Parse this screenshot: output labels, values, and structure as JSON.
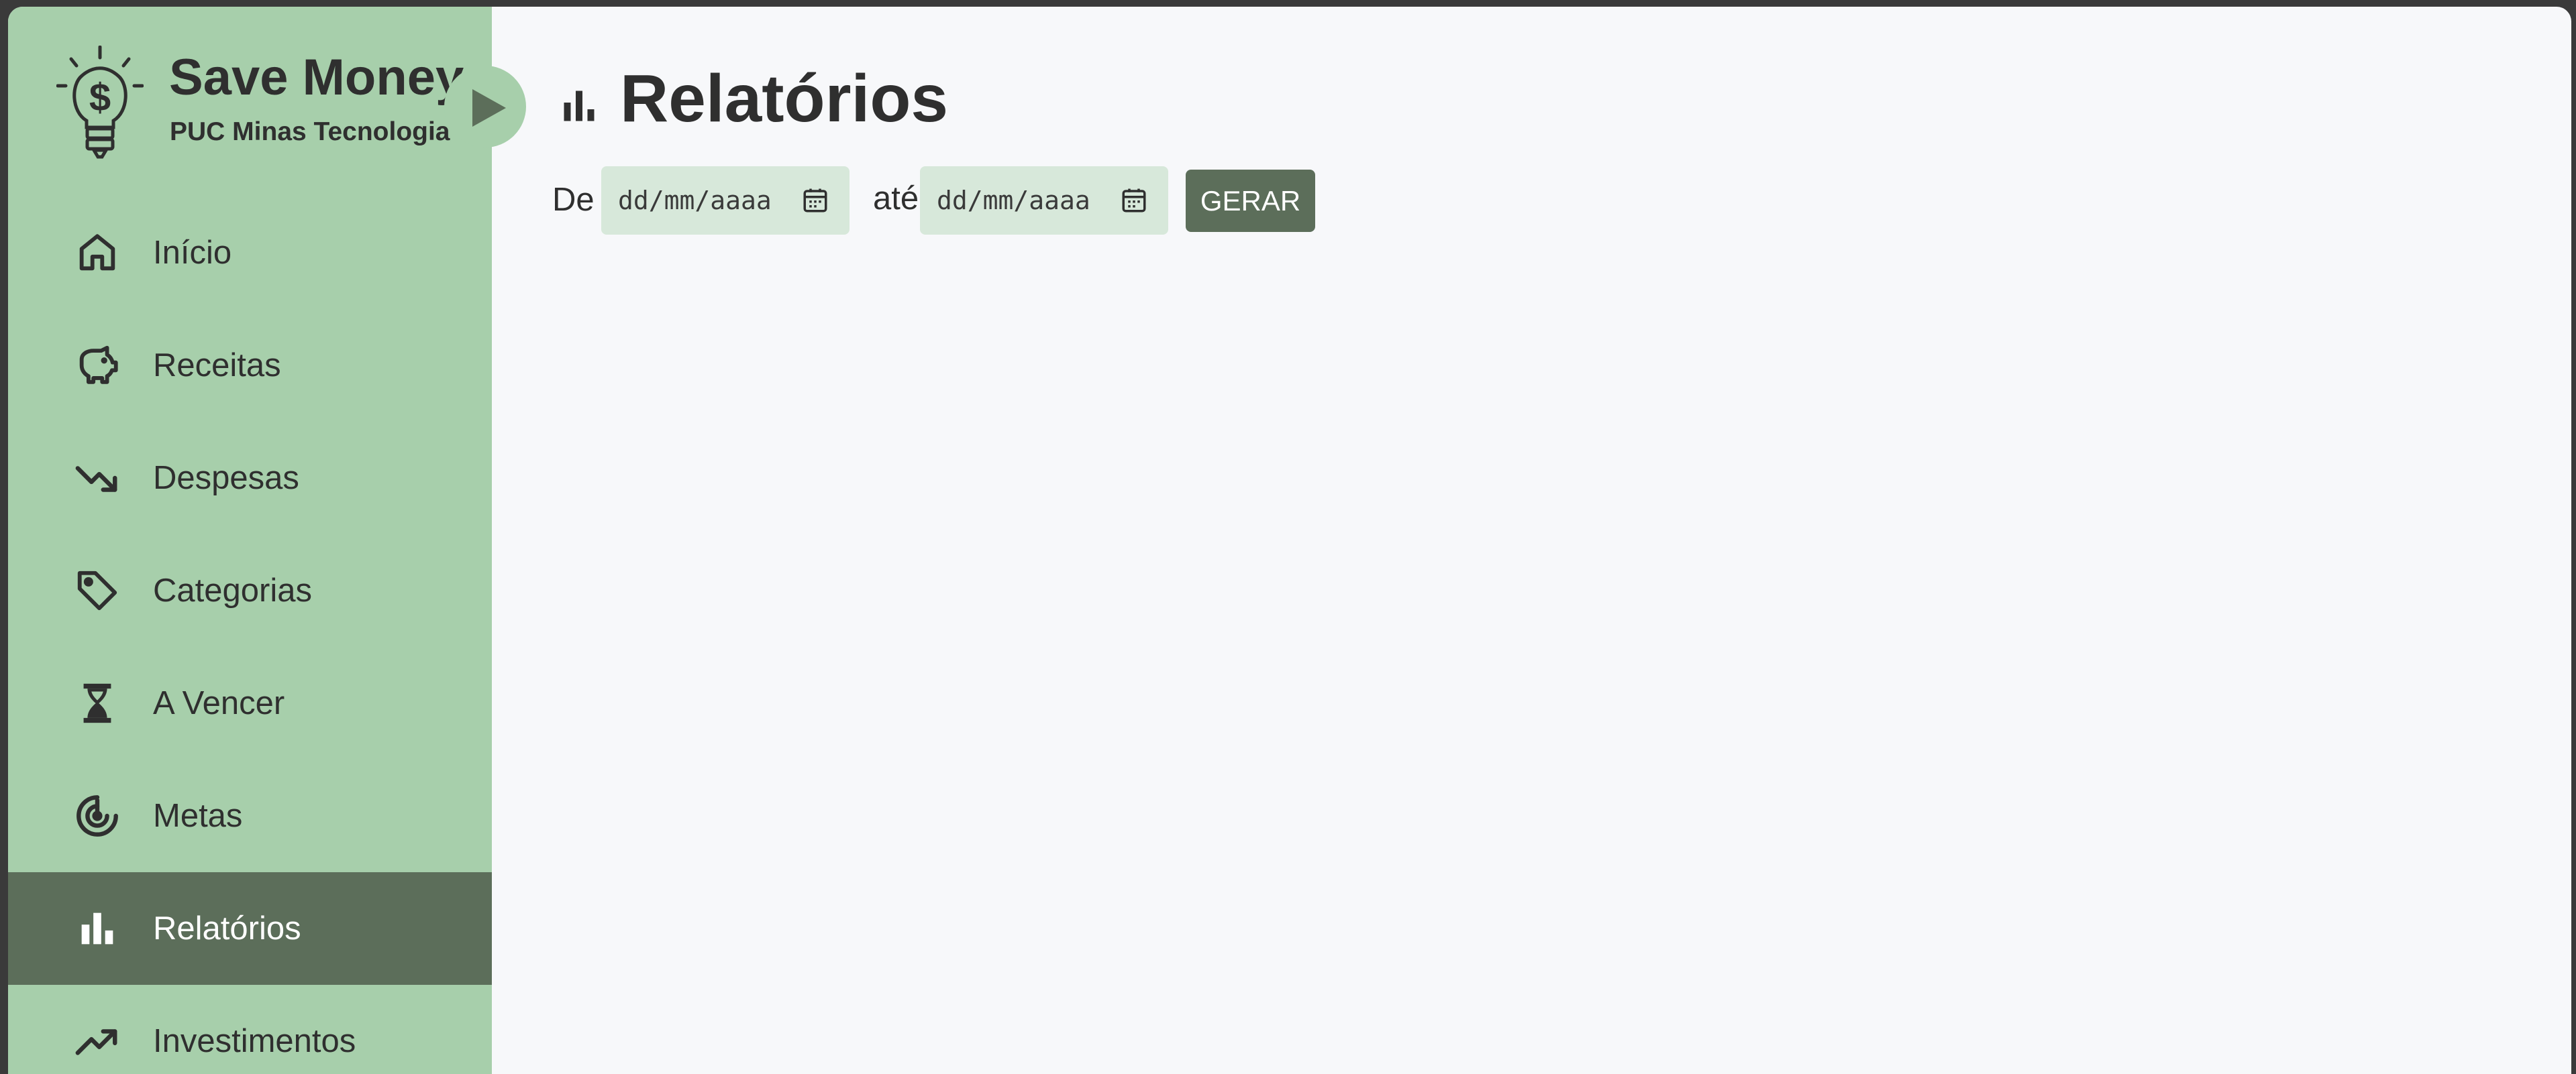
{
  "brand": {
    "title": "Save Money",
    "subtitle": "PUC Minas Tecnologia",
    "logo_icon": "lightbulb-dollar-icon"
  },
  "sidebar_toggle_icon": "play-arrow-icon",
  "nav": {
    "items": [
      {
        "label": "Início",
        "icon": "home-icon",
        "active": false
      },
      {
        "label": "Receitas",
        "icon": "piggy-bank-icon",
        "active": false
      },
      {
        "label": "Despesas",
        "icon": "trending-down-icon",
        "active": false
      },
      {
        "label": "Categorias",
        "icon": "tag-icon",
        "active": false
      },
      {
        "label": "A Vencer",
        "icon": "hourglass-icon",
        "active": false
      },
      {
        "label": "Metas",
        "icon": "target-icon",
        "active": false
      },
      {
        "label": "Relatórios",
        "icon": "bar-chart-icon",
        "active": true
      },
      {
        "label": "Investimentos",
        "icon": "trending-up-icon",
        "active": false
      }
    ]
  },
  "page": {
    "title": "Relatórios",
    "icon": "bar-chart-icon"
  },
  "filters": {
    "from_label": "De",
    "from_placeholder": "dd/mm/aaaa",
    "to_label": "até",
    "to_placeholder": "dd/mm/aaaa",
    "generate_label": "GERAR"
  },
  "colors": {
    "sidebar": "#a7cfab",
    "active": "#5c6e5a",
    "input_bg": "#d7e8da",
    "content_bg": "#f7f8fa"
  }
}
